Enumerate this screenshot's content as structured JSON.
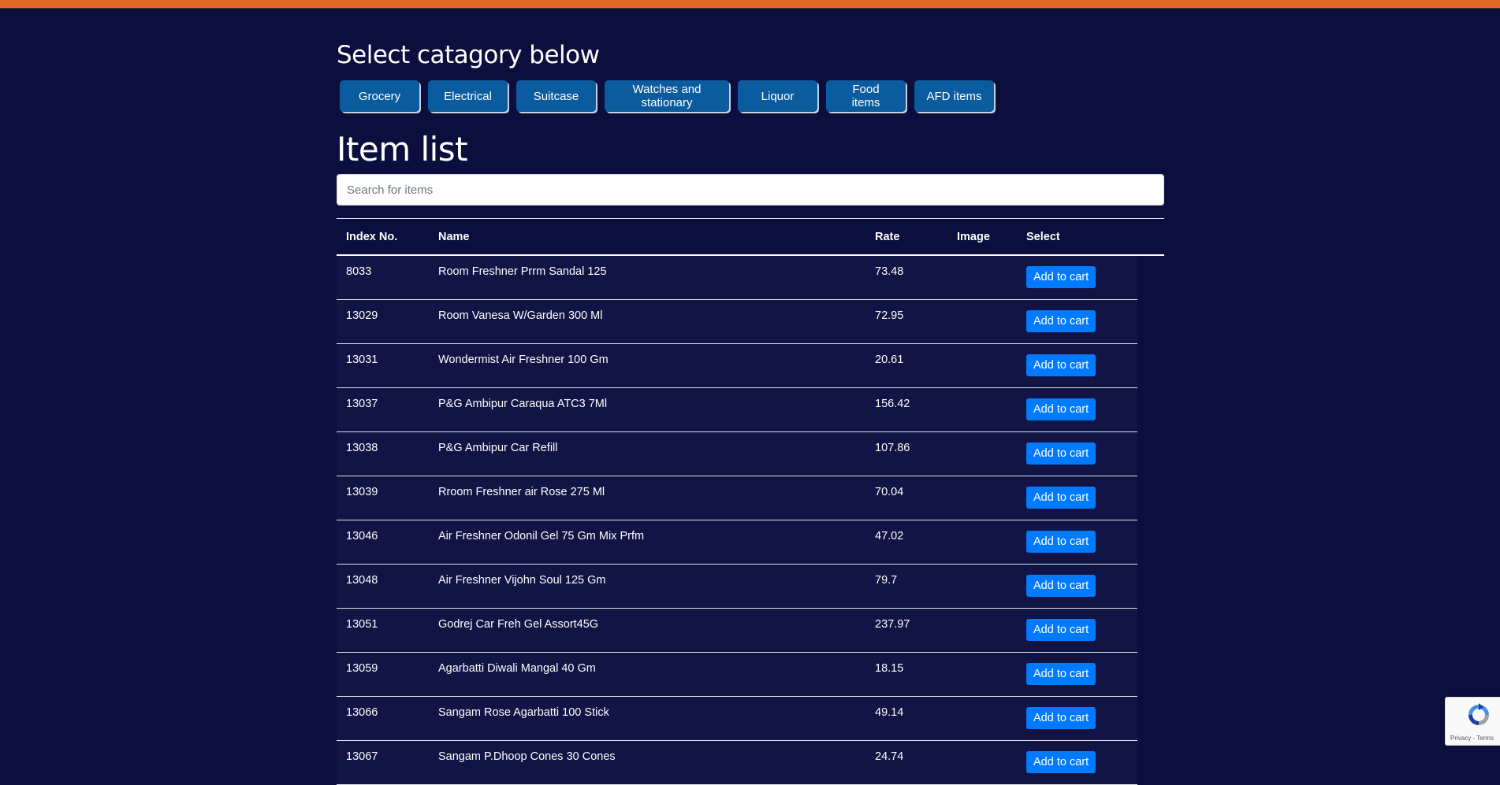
{
  "colors": {
    "background": "#0c0f3d",
    "top_bar": "#e06a26",
    "category_button": "#0b5c9e",
    "add_button": "#007bff",
    "row_background": "#111444"
  },
  "categories": {
    "title": "Select catagory below",
    "buttons": [
      "Grocery",
      "Electrical",
      "Suitcase",
      "Watches and stationary",
      "Liquor",
      "Food items",
      "AFD items"
    ]
  },
  "item_list": {
    "title": "Item list",
    "search_placeholder": "Search for items",
    "columns": [
      "Index No.",
      "Name",
      "Rate",
      "Image",
      "Select"
    ],
    "add_label": "Add to cart",
    "rows": [
      {
        "index": "8033",
        "name": "Room Freshner Prrm Sandal 125",
        "rate": "73.48"
      },
      {
        "index": "13029",
        "name": "Room Vanesa W/Garden 300 Ml",
        "rate": "72.95"
      },
      {
        "index": "13031",
        "name": "Wondermist Air Freshner 100 Gm",
        "rate": "20.61"
      },
      {
        "index": "13037",
        "name": "P&G Ambipur Caraqua ATC3 7Ml",
        "rate": "156.42"
      },
      {
        "index": "13038",
        "name": "P&G Ambipur Car Refill",
        "rate": "107.86"
      },
      {
        "index": "13039",
        "name": "Rroom Freshner air Rose 275 Ml",
        "rate": "70.04"
      },
      {
        "index": "13046",
        "name": "Air Freshner Odonil Gel 75 Gm Mix Prfm",
        "rate": "47.02"
      },
      {
        "index": "13048",
        "name": "Air Freshner Vijohn Soul 125 Gm",
        "rate": "79.7"
      },
      {
        "index": "13051",
        "name": "Godrej Car Freh Gel Assort45G",
        "rate": "237.97"
      },
      {
        "index": "13059",
        "name": "Agarbatti Diwali Mangal 40 Gm",
        "rate": "18.15"
      },
      {
        "index": "13066",
        "name": "Sangam Rose Agarbatti 100 Stick",
        "rate": "49.14"
      },
      {
        "index": "13067",
        "name": "Sangam P.Dhoop Cones 30 Cones",
        "rate": "24.74"
      }
    ]
  },
  "recaptcha": {
    "icon": "recaptcha-icon",
    "terms": "Privacy - Terms"
  }
}
